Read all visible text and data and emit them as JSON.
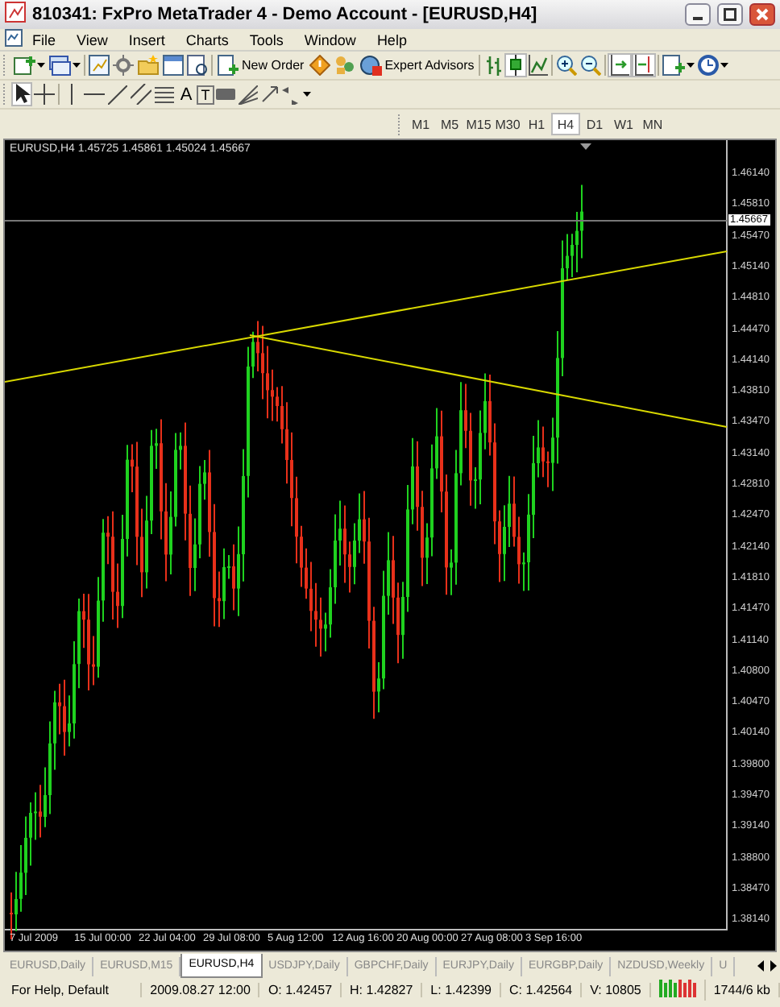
{
  "window": {
    "title": "810341: FxPro MetaTrader 4 - Demo Account - [EURUSD,H4]"
  },
  "menu": [
    "File",
    "View",
    "Insert",
    "Charts",
    "Tools",
    "Window",
    "Help"
  ],
  "toolbar": {
    "new_order": "New Order",
    "expert_advisors": "Expert Advisors",
    "chart_types": [
      {
        "selected": false
      },
      {
        "selected": true
      },
      {
        "selected": false
      }
    ],
    "auto_scroll": {
      "on": true
    },
    "chart_shift": {
      "on": true
    }
  },
  "line_studies": {
    "cursor": {
      "selected": true
    },
    "crosshair": {
      "selected": false
    },
    "text_tool": "A",
    "label_tool": "T"
  },
  "timeframes": [
    {
      "label": "M1",
      "selected": false
    },
    {
      "label": "M5",
      "selected": false
    },
    {
      "label": "M15",
      "selected": false
    },
    {
      "label": "M30",
      "selected": false
    },
    {
      "label": "H1",
      "selected": false
    },
    {
      "label": "H4",
      "selected": true
    },
    {
      "label": "D1",
      "selected": false
    },
    {
      "label": "W1",
      "selected": false
    },
    {
      "label": "MN",
      "selected": false
    }
  ],
  "chart": {
    "legend": "EURUSD,H4  1.45725 1.45861 1.45024 1.45667",
    "current_price": "1.45667",
    "price_labels": [
      "1.46140",
      "1.45810",
      "1.45470",
      "1.45140",
      "1.44810",
      "1.44470",
      "1.44140",
      "1.43810",
      "1.43470",
      "1.43140",
      "1.42810",
      "1.42470",
      "1.42140",
      "1.41810",
      "1.41470",
      "1.41140",
      "1.40800",
      "1.40470",
      "1.40140",
      "1.39800",
      "1.39470",
      "1.39140",
      "1.38800",
      "1.38470",
      "1.38140"
    ],
    "time_labels": [
      "7 Jul 2009",
      "15 Jul 00:00",
      "22 Jul 04:00",
      "29 Jul 08:00",
      "5 Aug 12:00",
      "12 Aug 16:00",
      "20 Aug 00:00",
      "27 Aug 08:00",
      "3 Sep 16:00"
    ]
  },
  "tabs": [
    {
      "label": "EURUSD,Daily",
      "selected": false
    },
    {
      "label": "EURUSD,M15",
      "selected": false
    },
    {
      "label": "EURUSD,H4",
      "selected": true
    },
    {
      "label": "USDJPY,Daily",
      "selected": false
    },
    {
      "label": "GBPCHF,Daily",
      "selected": false
    },
    {
      "label": "EURJPY,Daily",
      "selected": false
    },
    {
      "label": "EURGBP,Daily",
      "selected": false
    },
    {
      "label": "NZDUSD,Weekly",
      "selected": false
    },
    {
      "label": "U",
      "selected": false
    }
  ],
  "status_bar": [
    "For Help, Default",
    "2009.08.27 12:00",
    "O: 1.42457",
    "H: 1.42827",
    "L: 1.42399",
    "C: 1.42564",
    "V: 10805",
    "1744/6 kb"
  ]
}
